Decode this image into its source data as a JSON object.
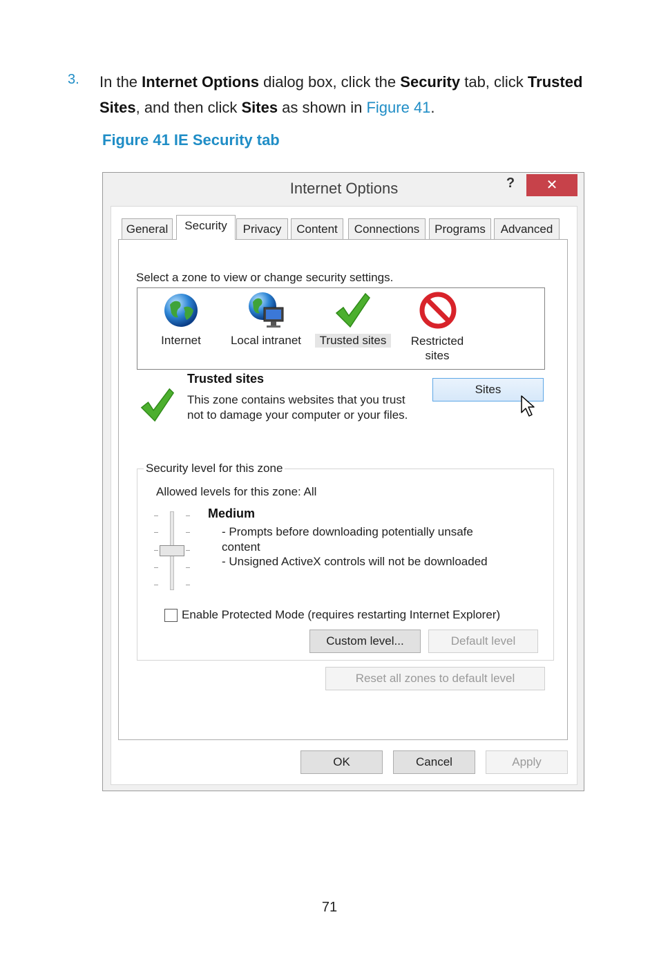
{
  "doc": {
    "step_number": "3.",
    "step_parts": {
      "p1": "In the ",
      "b1": "Internet Options",
      "p2": " dialog box, click the ",
      "b2": "Security",
      "p3": " tab, click ",
      "b3": "Trusted Sites",
      "p4": ", and then click ",
      "b4": "Sites",
      "p5": " as shown in ",
      "link": "Figure 41",
      "p6": "."
    },
    "figure_caption": "Figure 41 IE Security tab",
    "page_number": "71"
  },
  "dialog": {
    "title": "Internet Options",
    "help_label": "?",
    "close_label": "✕",
    "tabs": [
      "General",
      "Security",
      "Privacy",
      "Content",
      "Connections",
      "Programs",
      "Advanced"
    ],
    "active_tab": "Security",
    "select_zone_text": "Select a zone to view or change security settings.",
    "zones": [
      {
        "label": "Internet",
        "icon": "globe-icon"
      },
      {
        "label": "Local intranet",
        "icon": "intranet-globe-icon"
      },
      {
        "label": "Trusted sites",
        "icon": "checkmark-icon"
      },
      {
        "label": "Restricted sites",
        "icon": "restricted-icon"
      }
    ],
    "selected_zone": {
      "title": "Trusted sites",
      "description": "This zone contains websites that you trust not to damage your computer or your files.",
      "sites_button": "Sites"
    },
    "security_level": {
      "legend": "Security level for this zone",
      "allowed_levels": "Allowed levels for this zone: All",
      "level_name": "Medium",
      "bullets": [
        "- Prompts before downloading potentially unsafe content",
        "- Unsigned ActiveX controls will not be downloaded"
      ],
      "slider_level": 3,
      "slider_levels_total": 5,
      "protected_mode_label": "Enable Protected Mode (requires restarting Internet Explorer)",
      "protected_mode_checked": false,
      "custom_level_button": "Custom level...",
      "default_level_button": "Default level"
    },
    "reset_all_button": "Reset all zones to default level",
    "ok_button": "OK",
    "cancel_button": "Cancel",
    "apply_button": "Apply"
  },
  "colors": {
    "accent_blue": "#1f8dc6",
    "close_red": "#c7424a",
    "check_green": "#4caf2e",
    "restricted_red": "#d8232a"
  }
}
